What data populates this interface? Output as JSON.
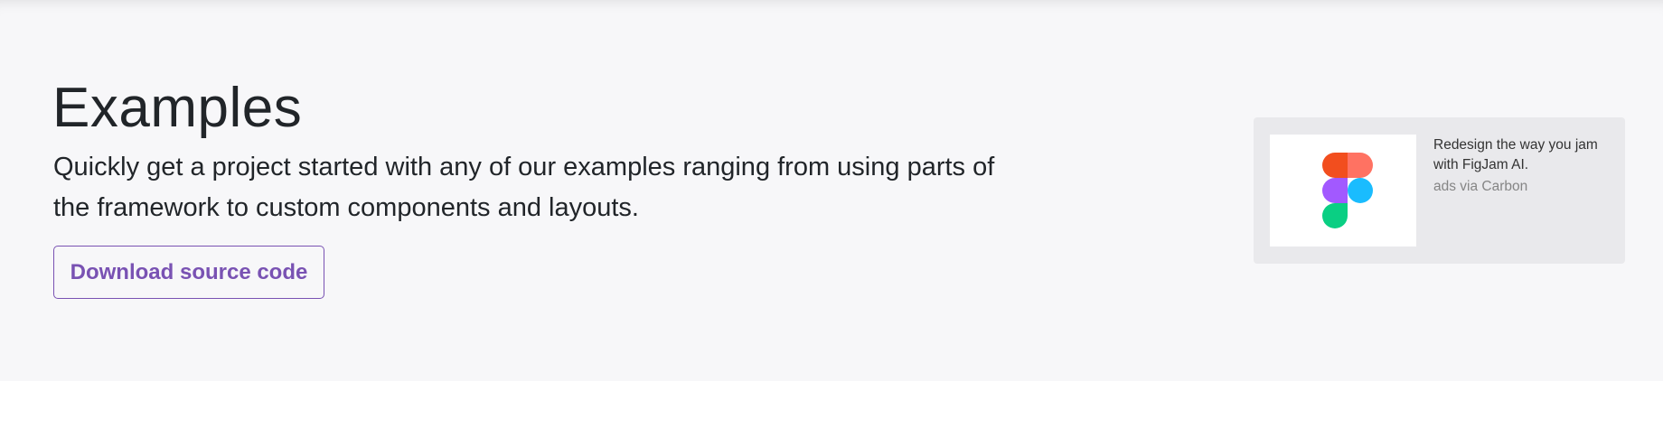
{
  "hero": {
    "title": "Examples",
    "lead": "Quickly get a project started with any of our examples ranging from using parts of the framework to custom components and layouts.",
    "download_button": "Download source code"
  },
  "ad": {
    "logo_icon": "figma-logo-icon",
    "text": "Redesign the way you jam with FigJam AI.",
    "via": "ads via Carbon",
    "colors": {
      "red": "#f24e1e",
      "coral": "#ff7262",
      "purple": "#a259ff",
      "blue": "#1abcfe",
      "green": "#0acf83"
    }
  },
  "colors": {
    "hero_background": "#f7f7f9",
    "accent": "#7952b3",
    "text": "#212529",
    "ad_background": "#e9e9ec"
  }
}
